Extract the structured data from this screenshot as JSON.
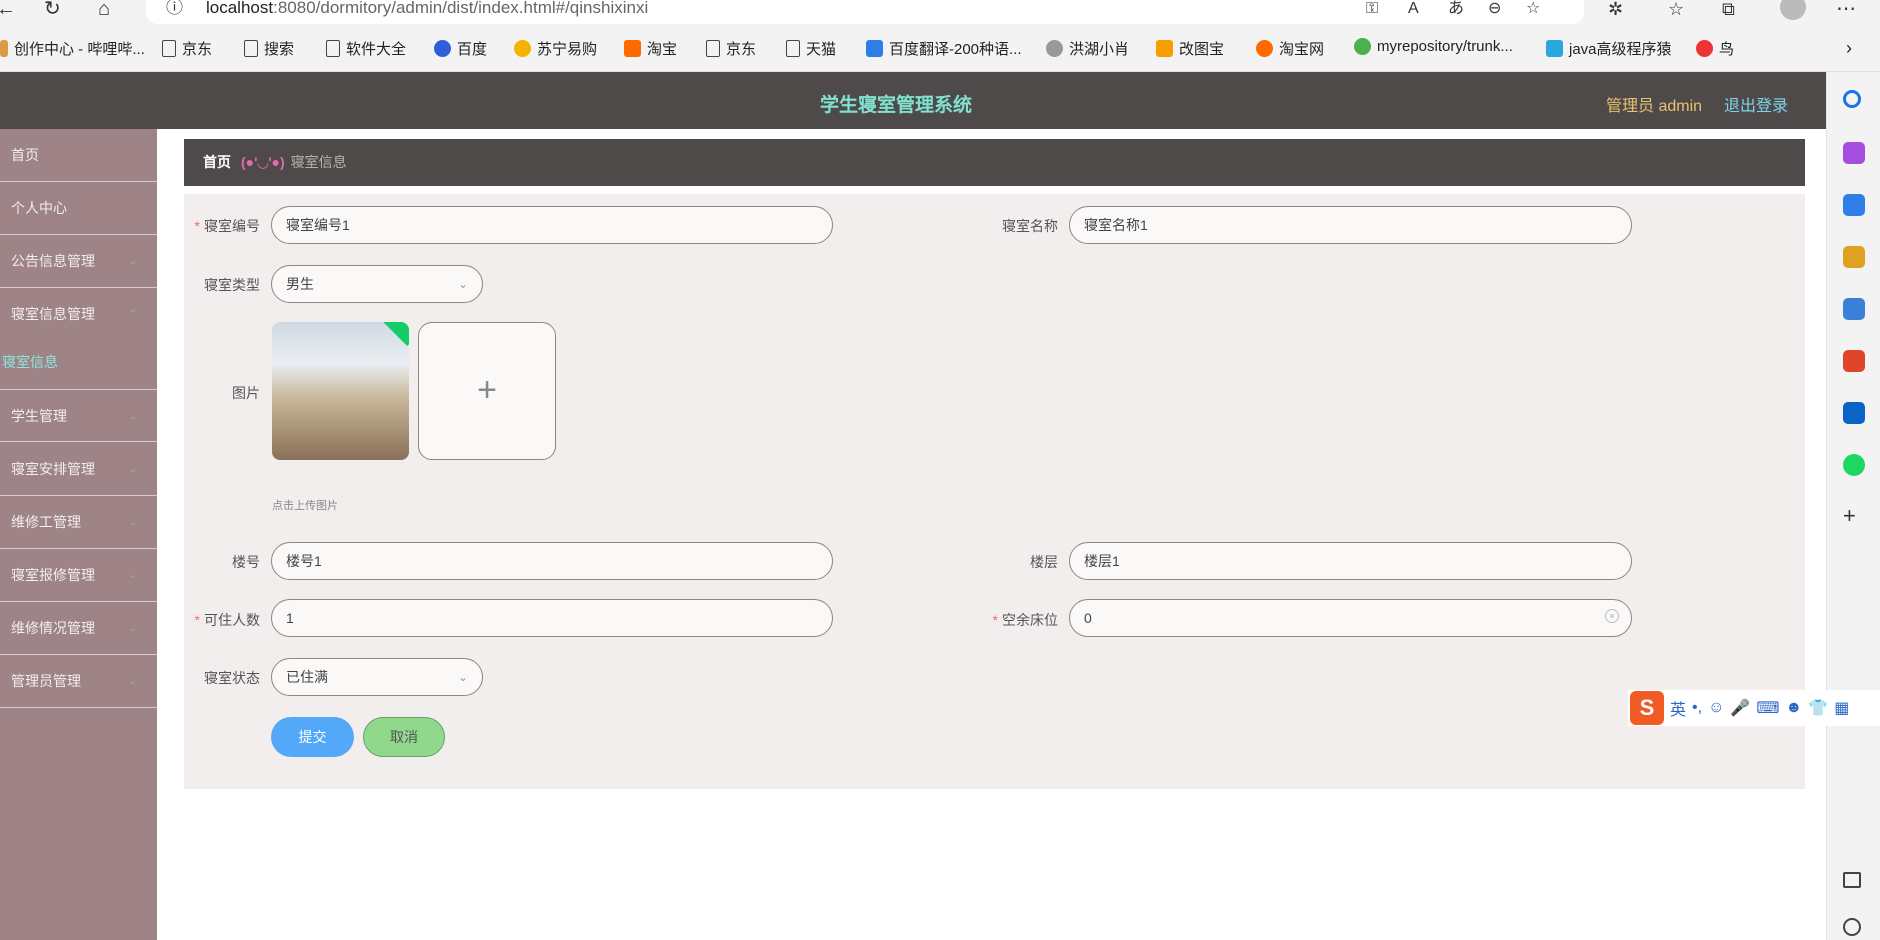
{
  "browser": {
    "url_host": "localhost",
    "url_rest": ":8080/dormitory/admin/dist/index.html#/qinshixinxi",
    "bookmarks": [
      "创作中心 - 哔哩哔...",
      "京东",
      "搜索",
      "软件大全",
      "百度",
      "苏宁易购",
      "淘宝",
      "京东",
      "天猫",
      "百度翻译-200种语...",
      "洪湖小肖",
      "改图宝",
      "淘宝网",
      "myrepository/trunk...",
      "java高级程序猿",
      "鸟"
    ]
  },
  "header": {
    "title": "学生寝室管理系统",
    "admin_label": "管理员 admin",
    "logout_label": "退出登录"
  },
  "sidebar": {
    "items": [
      "首页",
      "个人中心",
      "公告信息管理",
      "寝室信息管理",
      "学生管理",
      "寝室安排管理",
      "维修工管理",
      "寝室报修管理",
      "维修情况管理",
      "管理员管理"
    ],
    "active_sub": "寝室信息"
  },
  "breadcrumb": {
    "home": "首页",
    "separator": "(●'◡'●)",
    "current": "寝室信息"
  },
  "form": {
    "room_no": {
      "label": "寝室编号",
      "value": "寝室编号1"
    },
    "room_name": {
      "label": "寝室名称",
      "value": "寝室名称1"
    },
    "room_type": {
      "label": "寝室类型",
      "value": "男生"
    },
    "image": {
      "label": "图片",
      "tip": "点击上传图片"
    },
    "building": {
      "label": "楼号",
      "value": "楼号1"
    },
    "floor": {
      "label": "楼层",
      "value": "楼层1"
    },
    "capacity": {
      "label": "可住人数",
      "value": "1"
    },
    "free_beds": {
      "label": "空余床位",
      "value": "0"
    },
    "status": {
      "label": "寝室状态",
      "value": "已住满"
    }
  },
  "buttons": {
    "submit": "提交",
    "cancel": "取消"
  },
  "ime": {
    "mode": "英"
  }
}
